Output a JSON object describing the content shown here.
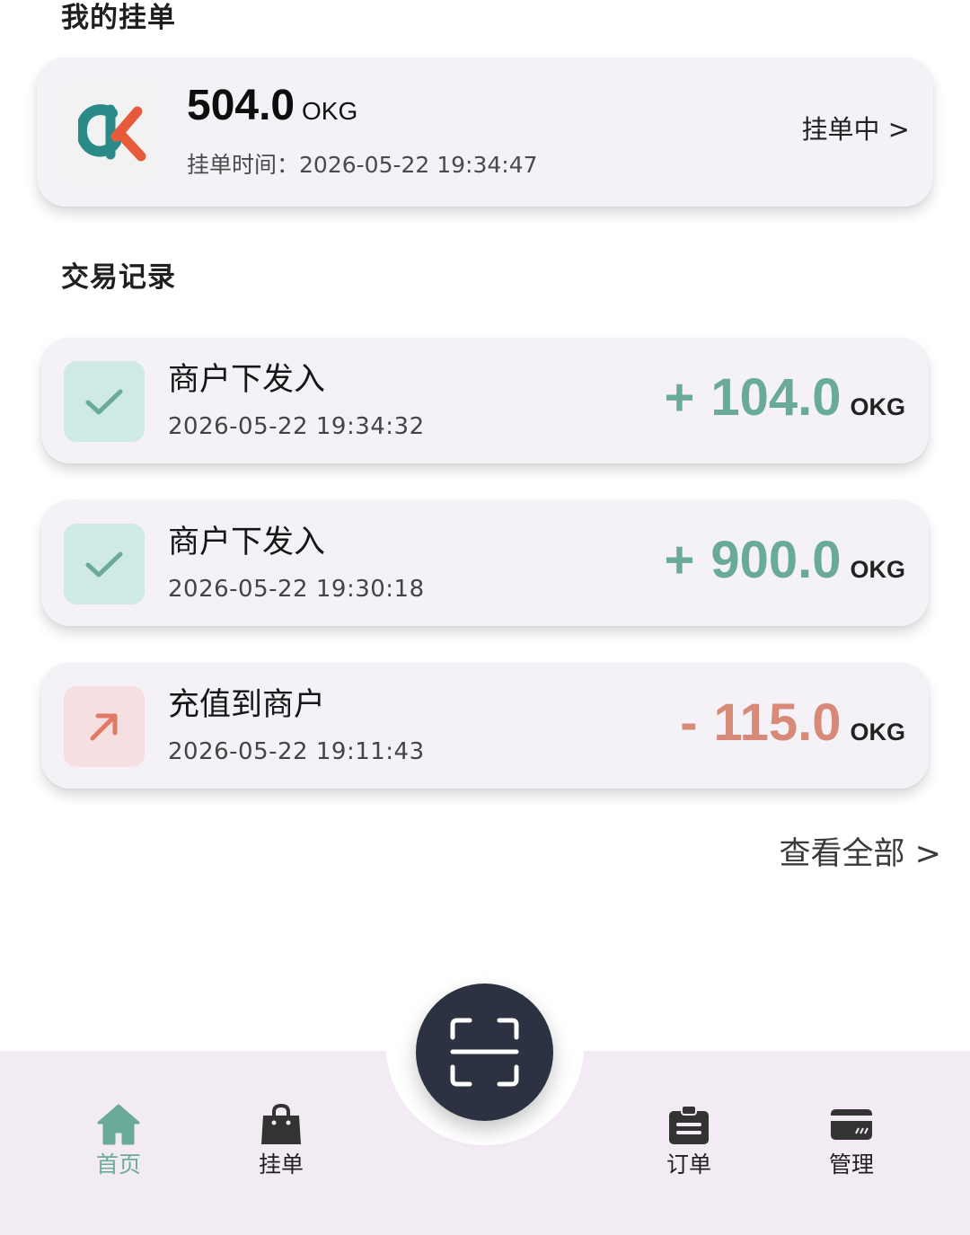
{
  "my_orders": {
    "title": "我的挂单",
    "order": {
      "amount": "504.0",
      "unit": "OKG",
      "time_label": "挂单时间：",
      "time": "2026-05-22 19:34:47",
      "status": "挂单中 >",
      "logo_icon": "ok-logo-icon"
    }
  },
  "transactions": {
    "title": "交易记录",
    "items": [
      {
        "title": "商户下发入",
        "time": "2026-05-22 19:34:32",
        "sign": "+",
        "value": "104.0",
        "unit": "OKG",
        "type": "in",
        "icon": "check-icon"
      },
      {
        "title": "商户下发入",
        "time": "2026-05-22 19:30:18",
        "sign": "+",
        "value": "900.0",
        "unit": "OKG",
        "type": "in",
        "icon": "check-icon"
      },
      {
        "title": "充值到商户",
        "time": "2026-05-22 19:11:43",
        "sign": "-",
        "value": "115.0",
        "unit": "OKG",
        "type": "out",
        "icon": "arrow-up-right-icon"
      }
    ],
    "view_all": "查看全部 >"
  },
  "bottom_nav": {
    "items": [
      {
        "label": "首页",
        "icon": "home-icon",
        "active": true
      },
      {
        "label": "挂单",
        "icon": "shopping-bag-icon",
        "active": false
      },
      {
        "label": "订单",
        "icon": "clipboard-icon",
        "active": false
      },
      {
        "label": "管理",
        "icon": "card-icon",
        "active": false
      }
    ],
    "scan_icon": "scan-icon"
  },
  "colors": {
    "accent_green": "#6aaa99",
    "accent_red": "#d88a78",
    "scan_button_bg": "#2c3242",
    "nav_bg": "#f3ebf4",
    "card_bg": "#f4f2f7"
  }
}
